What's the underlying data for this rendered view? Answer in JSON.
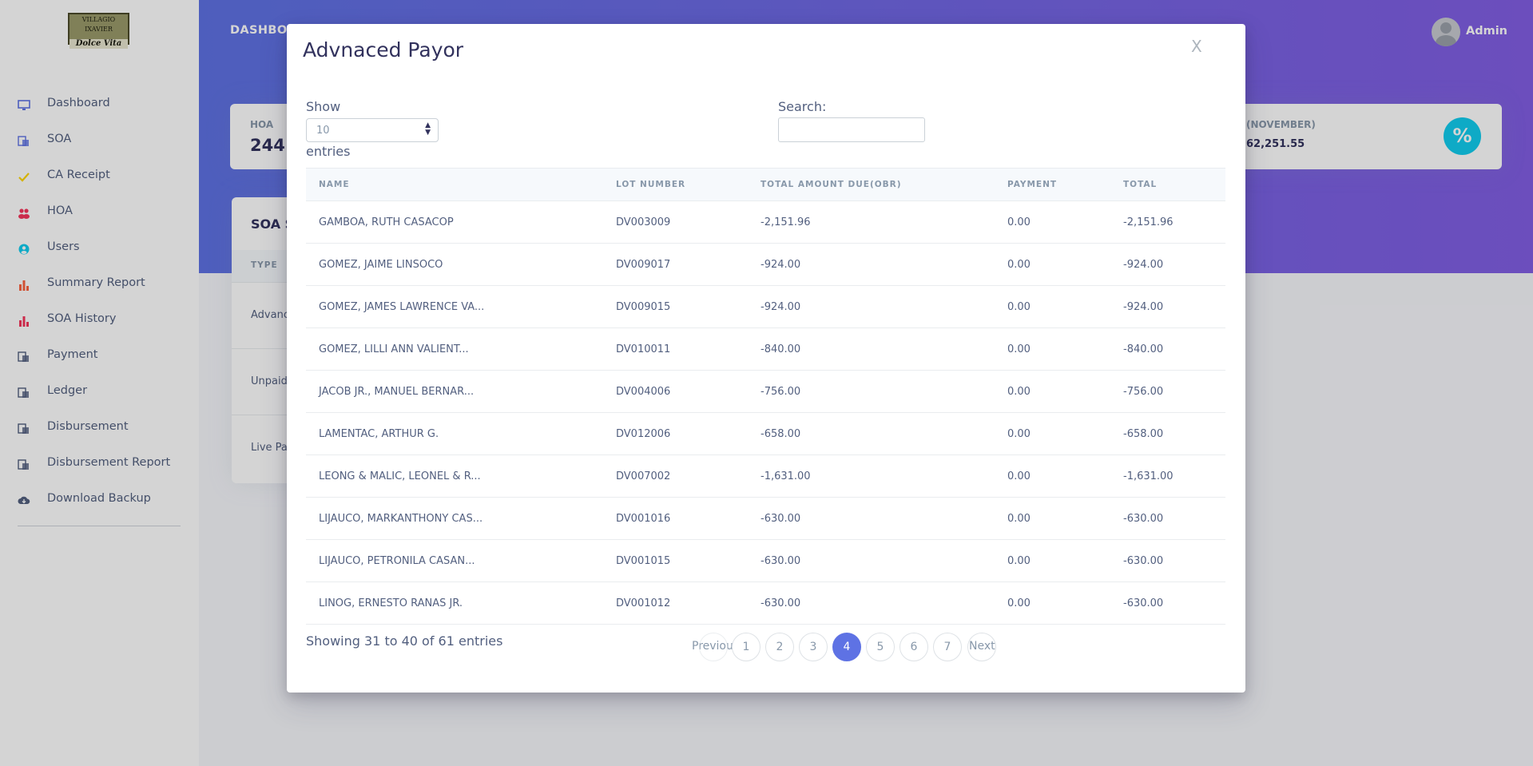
{
  "brand": {
    "logo_line1": "VILLAGIO IXAVIER",
    "logo_line2": "Dolce Vita"
  },
  "sidebar": {
    "items": [
      {
        "label": "Dashboard",
        "icon": "monitor-icon",
        "color": "#5e72e4"
      },
      {
        "label": "SOA",
        "icon": "file-stack-icon",
        "color": "#5e72e4"
      },
      {
        "label": "CA Receipt",
        "icon": "check-icon",
        "color": "#ffd600"
      },
      {
        "label": "HOA",
        "icon": "users-icon",
        "color": "#f5365c"
      },
      {
        "label": "Users",
        "icon": "user-circle-icon",
        "color": "#11cdef"
      },
      {
        "label": "Summary Report",
        "icon": "bar-chart-icon",
        "color": "#fb6340"
      },
      {
        "label": "SOA History",
        "icon": "bar-chart-icon",
        "color": "#f5365c"
      },
      {
        "label": "Payment",
        "icon": "file-stack-icon",
        "color": "#525f7f"
      },
      {
        "label": "Ledger",
        "icon": "file-stack-icon",
        "color": "#525f7f"
      },
      {
        "label": "Disbursement",
        "icon": "file-stack-icon",
        "color": "#525f7f"
      },
      {
        "label": "Disbursement Report",
        "icon": "file-stack-icon",
        "color": "#525f7f"
      },
      {
        "label": "Download Backup",
        "icon": "cloud-download-icon",
        "color": "#525f7f"
      }
    ]
  },
  "header": {
    "title": "DASHBOA",
    "user_name": "Admin"
  },
  "cards": {
    "hoa": {
      "title": "HOA",
      "value": "244"
    },
    "november": {
      "title": "(NOVEMBER)",
      "value": "62,251.55",
      "icon": "percent-icon"
    }
  },
  "soa_panel": {
    "title": "SOA S",
    "col_type": "TYPE",
    "rows": [
      "Advanc",
      "Unpaid",
      "Live Pay"
    ]
  },
  "modal": {
    "title": "Advnaced Payor",
    "close": "X",
    "show_label": "Show",
    "show_value": "10",
    "entries_label": "entries",
    "search_label": "Search:",
    "columns": [
      "NAME",
      "LOT NUMBER",
      "TOTAL AMOUNT DUE(OBR)",
      "PAYMENT",
      "TOTAL"
    ],
    "rows": [
      [
        "GAMBOA, RUTH CASACOP",
        "DV003009",
        "-2,151.96",
        "0.00",
        "-2,151.96"
      ],
      [
        "GOMEZ, JAIME LINSOCO",
        "DV009017",
        "-924.00",
        "0.00",
        "-924.00"
      ],
      [
        "GOMEZ, JAMES LAWRENCE VA...",
        "DV009015",
        "-924.00",
        "0.00",
        "-924.00"
      ],
      [
        "GOMEZ, LILLI ANN VALIENT...",
        "DV010011",
        "-840.00",
        "0.00",
        "-840.00"
      ],
      [
        "JACOB JR., MANUEL BERNAR...",
        "DV004006",
        "-756.00",
        "0.00",
        "-756.00"
      ],
      [
        "LAMENTAC, ARTHUR G.",
        "DV012006",
        "-658.00",
        "0.00",
        "-658.00"
      ],
      [
        "LEONG & MALIC, LEONEL & R...",
        "DV007002",
        "-1,631.00",
        "0.00",
        "-1,631.00"
      ],
      [
        "LIJAUCO, MARKANTHONY CAS...",
        "DV001016",
        "-630.00",
        "0.00",
        "-630.00"
      ],
      [
        "LIJAUCO, PETRONILA CASAN...",
        "DV001015",
        "-630.00",
        "0.00",
        "-630.00"
      ],
      [
        "LINOG, ERNESTO RANAS JR.",
        "DV001012",
        "-630.00",
        "0.00",
        "-630.00"
      ]
    ],
    "info": "Showing 31 to 40 of 61 entries",
    "pagination": {
      "previous": "Previous",
      "next": "Next",
      "pages": [
        "1",
        "2",
        "3",
        "4",
        "5",
        "6",
        "7"
      ],
      "current": "4"
    }
  }
}
